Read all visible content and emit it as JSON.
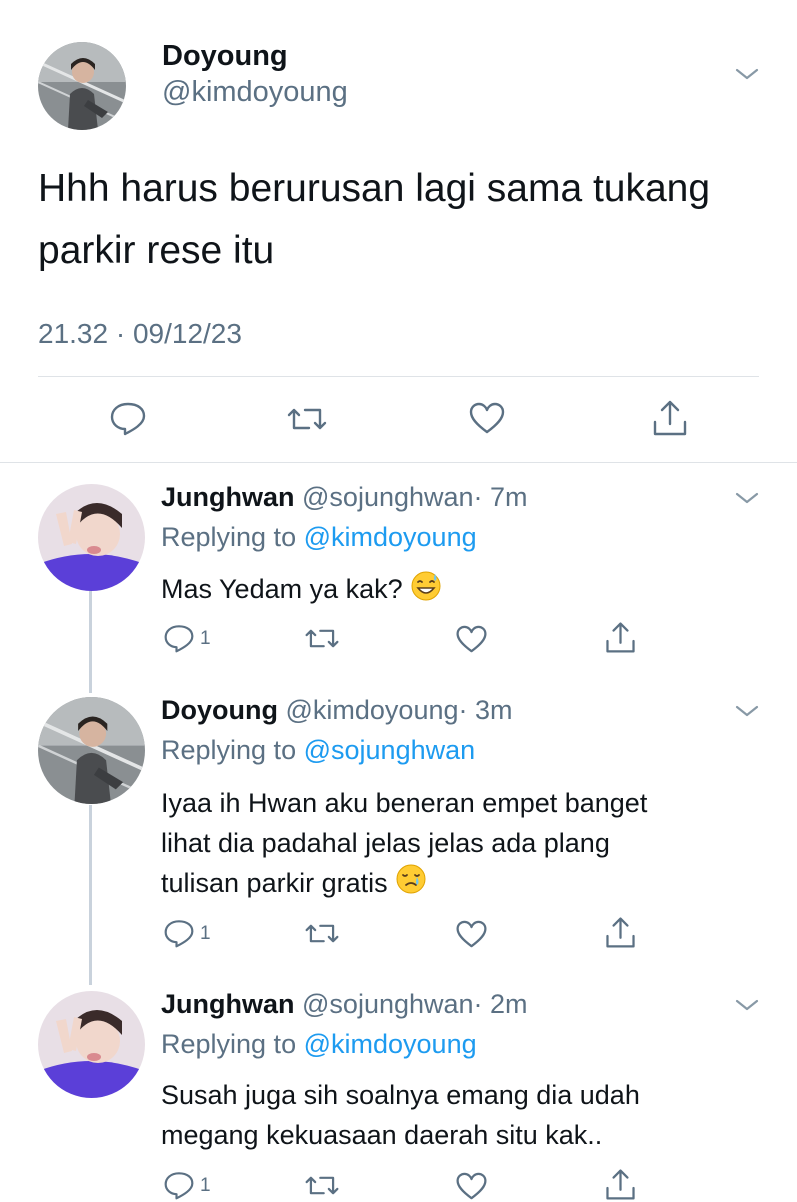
{
  "main_tweet": {
    "display_name": "Doyoung",
    "handle": "@kimdoyoung",
    "text_line1": "Hhh harus berurusan lagi sama tukang",
    "text_line2": "parkir rese itu",
    "timestamp": "21.32 · 09/12/23"
  },
  "replies": [
    {
      "display_name": "Junghwan",
      "handle": "@sojunghwan",
      "time": "· 7m",
      "replying_label": "Replying to",
      "replying_to": "@kimdoyoung",
      "lines": [
        "Mas Yedam ya kak?"
      ],
      "emoji": "sweat-smile",
      "reply_count": "1"
    },
    {
      "display_name": "Doyoung",
      "handle": "@kimdoyoung",
      "time": "· 3m",
      "replying_label": "Replying to",
      "replying_to": "@sojunghwan",
      "lines": [
        "Iyaa ih Hwan aku beneran empet banget",
        "lihat dia padahal jelas jelas ada plang",
        "tulisan parkir gratis"
      ],
      "emoji": "crying-smile",
      "reply_count": "1"
    },
    {
      "display_name": "Junghwan",
      "handle": "@sojunghwan",
      "time": "· 2m",
      "replying_label": "Replying to",
      "replying_to": "@kimdoyoung",
      "lines": [
        "Susah juga sih soalnya emang dia udah",
        "megang kekuasaan daerah situ kak.."
      ],
      "reply_count": "1"
    }
  ],
  "icons": [
    "chevron-down-icon",
    "reply-icon",
    "retweet-icon",
    "like-icon",
    "share-icon"
  ],
  "colors": {
    "link": "#1d9bf0",
    "secondary": "#5b7083",
    "text": "#0f1419",
    "divider": "#dfe3e7"
  }
}
